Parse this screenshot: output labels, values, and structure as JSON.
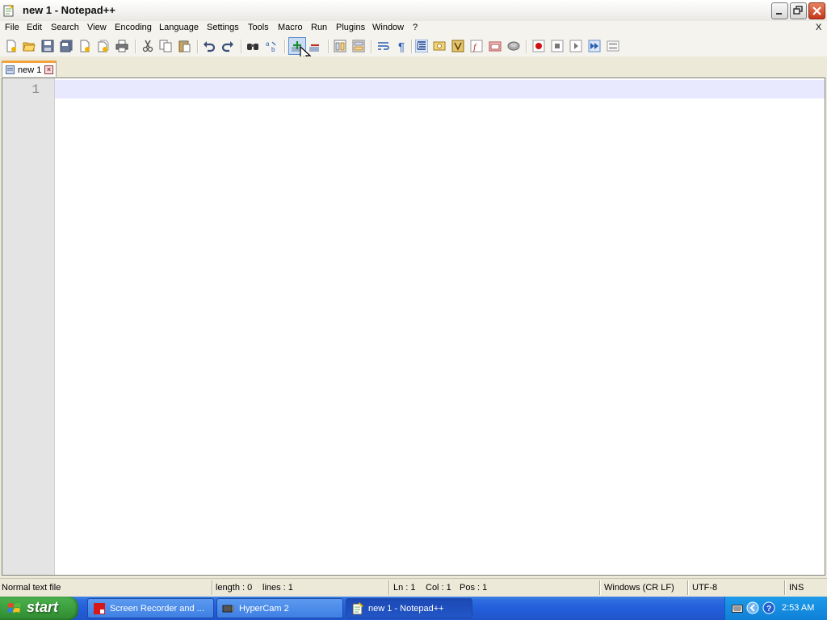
{
  "window": {
    "title": "new 1 - Notepad++"
  },
  "menu": {
    "items": [
      "File",
      "Edit",
      "Search",
      "View",
      "Encoding",
      "Language",
      "Settings",
      "Tools",
      "Macro",
      "Run",
      "Plugins",
      "Window",
      "?"
    ],
    "close_doc": "X"
  },
  "toolbar": {
    "icons": [
      "new-file-icon",
      "open-file-icon",
      "save-icon",
      "save-all-icon",
      "close-icon",
      "close-all-icon",
      "print-icon",
      "cut-icon",
      "copy-icon",
      "paste-icon",
      "undo-icon",
      "redo-icon",
      "find-icon",
      "replace-icon",
      "zoom-in-icon",
      "zoom-out-icon",
      "sync-vertical-icon",
      "sync-horizontal-icon",
      "word-wrap-icon",
      "show-all-chars-icon",
      "indent-guide-icon",
      "user-defined-language-icon",
      "doc-map-icon",
      "function-list-icon",
      "folder-as-workspace-icon",
      "monitoring-icon",
      "record-macro-icon",
      "stop-record-icon",
      "play-macro-icon",
      "run-macro-multiple-icon",
      "save-macro-icon"
    ]
  },
  "tabs": [
    {
      "label": "new 1"
    }
  ],
  "editor": {
    "line_numbers": [
      "1"
    ],
    "content": ""
  },
  "status": {
    "file_type": "Normal text file",
    "length": "length : 0",
    "lines": "lines : 1",
    "ln": "Ln : 1",
    "col": "Col : 1",
    "pos": "Pos : 1",
    "eol": "Windows (CR LF)",
    "encoding": "UTF-8",
    "mode": "INS"
  },
  "taskbar": {
    "start_label": "start",
    "tasks": [
      {
        "label": "Screen Recorder and ...",
        "icon": "screen-recorder-icon"
      },
      {
        "label": "HyperCam 2",
        "icon": "hypercam-icon"
      },
      {
        "label": "new 1 - Notepad++",
        "icon": "notepadpp-icon"
      }
    ],
    "clock": "2:53 AM"
  },
  "colors": {
    "title_close": "#c4361b",
    "active_tab_accent": "#f1a33a",
    "current_line": "#e8e8ff",
    "taskbar": "#245edb",
    "start_button": "#3a9a3c",
    "tray": "#0f80d8"
  }
}
